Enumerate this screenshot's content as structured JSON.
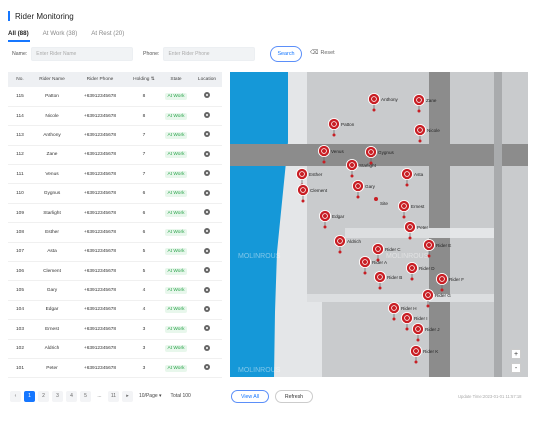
{
  "header": {
    "title": "Rider Monitoring"
  },
  "tabs": [
    {
      "label": "All (88)",
      "active": true
    },
    {
      "label": "At Work (38)",
      "active": false
    },
    {
      "label": "At Rest (20)",
      "active": false
    }
  ],
  "filters": {
    "name_label": "Name:",
    "name_placeholder": "Enter Rider Name",
    "phone_label": "Phone:",
    "phone_placeholder": "Enter Rider Phone",
    "search_label": "Search",
    "reset_label": "Reset"
  },
  "table": {
    "columns": [
      "No.",
      "Rider Name",
      "Rider Phone",
      "Holding",
      "State",
      "Location"
    ],
    "rows": [
      {
        "no": "115",
        "name": "Patton",
        "phone": "+63912345678",
        "holding": "8",
        "state": "At Work"
      },
      {
        "no": "114",
        "name": "Nicole",
        "phone": "+63912345678",
        "holding": "8",
        "state": "At Work"
      },
      {
        "no": "113",
        "name": "Anthony",
        "phone": "+63912345678",
        "holding": "7",
        "state": "At Work"
      },
      {
        "no": "112",
        "name": "Zane",
        "phone": "+63912345678",
        "holding": "7",
        "state": "At Work"
      },
      {
        "no": "111",
        "name": "Venus",
        "phone": "+63912345678",
        "holding": "7",
        "state": "At Work"
      },
      {
        "no": "110",
        "name": "Gygnus",
        "phone": "+63912345678",
        "holding": "6",
        "state": "At Work"
      },
      {
        "no": "109",
        "name": "Starlight",
        "phone": "+63912345678",
        "holding": "6",
        "state": "At Work"
      },
      {
        "no": "108",
        "name": "Esther",
        "phone": "+63912345678",
        "holding": "6",
        "state": "At Work"
      },
      {
        "no": "107",
        "name": "Asta",
        "phone": "+63912345678",
        "holding": "5",
        "state": "At Work"
      },
      {
        "no": "106",
        "name": "Clement",
        "phone": "+63912345678",
        "holding": "5",
        "state": "At Work"
      },
      {
        "no": "105",
        "name": "Gary",
        "phone": "+63912345678",
        "holding": "4",
        "state": "At Work"
      },
      {
        "no": "104",
        "name": "Edgar",
        "phone": "+63912345678",
        "holding": "4",
        "state": "At Work"
      },
      {
        "no": "103",
        "name": "Ernest",
        "phone": "+63912345678",
        "holding": "3",
        "state": "At Work"
      },
      {
        "no": "102",
        "name": "Aldrich",
        "phone": "+63912345678",
        "holding": "3",
        "state": "At Work"
      },
      {
        "no": "101",
        "name": "Peter",
        "phone": "+63912345678",
        "holding": "3",
        "state": "At Work"
      }
    ]
  },
  "pagination": {
    "pages": [
      "1",
      "2",
      "3",
      "4",
      "5",
      "...",
      "11"
    ],
    "current": "1",
    "per_page": "10/Page",
    "total": "Total 100"
  },
  "actions": {
    "view_all": "View All",
    "refresh": "Refresh"
  },
  "update_time": "Update Time:2023-01-01 11:57:18",
  "map": {
    "watermark": "MOLINROUS",
    "riders": [
      {
        "label": "Anthony"
      },
      {
        "label": "Zane"
      },
      {
        "label": "Patton"
      },
      {
        "label": "Nicole"
      },
      {
        "label": "Venus"
      },
      {
        "label": "Gygnus"
      },
      {
        "label": "Starlight"
      },
      {
        "label": "Esther"
      },
      {
        "label": "Asta"
      },
      {
        "label": "Clement"
      },
      {
        "label": "Gary"
      },
      {
        "label": "Ernest"
      },
      {
        "label": "Edgar"
      },
      {
        "label": "Peter"
      },
      {
        "label": "Aldrich"
      },
      {
        "label": "Rider C"
      },
      {
        "label": "Rider E"
      },
      {
        "label": "Rider A"
      },
      {
        "label": "Rider D"
      },
      {
        "label": "Rider B"
      },
      {
        "label": "Rider F"
      },
      {
        "label": "Rider G"
      },
      {
        "label": "Rider H"
      },
      {
        "label": "Rider I"
      },
      {
        "label": "Rider J"
      },
      {
        "label": "Rider K"
      }
    ],
    "dots": [
      {
        "label": "Site"
      }
    ],
    "zoom_in": "+",
    "zoom_out": "-"
  },
  "colors": {
    "accent": "#1677ff",
    "marker": "#c81e24",
    "water": "#1598d8",
    "road": "#8c8c8c",
    "success": "#2aa34a"
  }
}
